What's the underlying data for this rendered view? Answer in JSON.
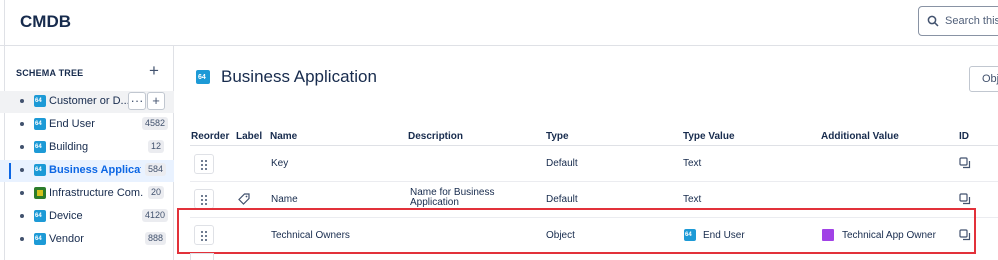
{
  "header": {
    "title": "CMDB",
    "search_placeholder": "Search this s"
  },
  "sidebar": {
    "section_label": "SCHEMA TREE",
    "items": [
      {
        "label": "Customer or D...",
        "count": "",
        "icon": "object-type-icon",
        "state": "hovered"
      },
      {
        "label": "End User",
        "count": "4582",
        "icon": "object-type-icon",
        "state": ""
      },
      {
        "label": "Building",
        "count": "12",
        "icon": "object-type-icon",
        "state": ""
      },
      {
        "label": "Business Applicati...",
        "count": "584",
        "icon": "object-type-icon",
        "state": "selected"
      },
      {
        "label": "Infrastructure Com...",
        "count": "20",
        "icon": "chip-icon",
        "state": ""
      },
      {
        "label": "Device",
        "count": "4120",
        "icon": "object-type-icon",
        "state": ""
      },
      {
        "label": "Vendor",
        "count": "888",
        "icon": "object-type-icon",
        "state": ""
      }
    ],
    "hover_actions": {
      "more": "···",
      "add": "+"
    }
  },
  "main": {
    "title": "Business Application",
    "object_button": "Obj",
    "columns": [
      "Reorder",
      "Label",
      "Name",
      "Description",
      "Type",
      "Type Value",
      "Additional Value",
      "ID"
    ],
    "rows": [
      {
        "name": "Key",
        "description": "",
        "type": "Default",
        "type_value": "Text",
        "additional_value": "",
        "has_label_icon": false
      },
      {
        "name": "Name",
        "description": "Name for Business Application",
        "description_line1": "Name for Business",
        "description_line2": "Application",
        "type": "Default",
        "type_value": "Text",
        "additional_value": "",
        "has_label_icon": true
      },
      {
        "name": "Technical Owners",
        "description": "",
        "type": "Object",
        "type_value": "End User",
        "additional_value": "Technical App Owner",
        "has_label_icon": false,
        "highlighted": true
      }
    ]
  },
  "colors": {
    "accent": "#0c66e4",
    "highlight_border": "#e2313a",
    "object_icon": "#1d9ad6",
    "additional_swatch": "#a142e6"
  }
}
